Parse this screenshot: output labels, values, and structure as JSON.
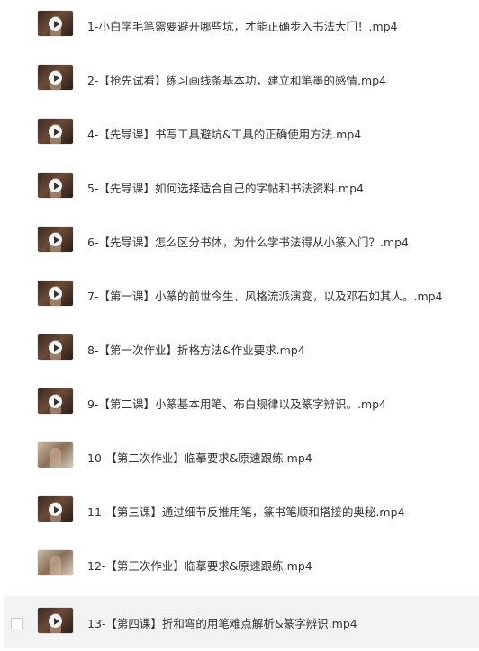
{
  "files": [
    {
      "name": "1-小白学毛笔需要避开哪些坑，才能正确步入书法大门！.mp4"
    },
    {
      "name": "2-【抢先试看】练习画线条基本功，建立和笔墨的感情.mp4"
    },
    {
      "name": "4-【先导课】书写工具避坑&工具的正确使用方法.mp4"
    },
    {
      "name": "5-【先导课】如何选择适合自己的字帖和书法资料.mp4"
    },
    {
      "name": "6-【先导课】怎么区分书体，为什么学书法得从小篆入门？.mp4"
    },
    {
      "name": "7-【第一课】小篆的前世今生、风格流派演变，以及邓石如其人。.mp4"
    },
    {
      "name": "8-【第一次作业】折格方法&作业要求.mp4"
    },
    {
      "name": "9-【第二课】小篆基本用笔、布白规律以及篆字辨识。.mp4"
    },
    {
      "name": "10-【第二次作业】临摹要求&原速跟练.mp4"
    },
    {
      "name": "11-【第三课】通过细节反推用笔，篆书笔顺和搭接的奥秘.mp4"
    },
    {
      "name": "12-【第三次作业】临摹要求&原速跟练.mp4"
    },
    {
      "name": "13-【第四课】折和弯的用笔难点解析&篆字辨识.mp4"
    }
  ],
  "icons": {
    "thumbnail": "video-thumbnail-icon",
    "play": "play-icon",
    "checkbox": "checkbox-icon"
  },
  "colors": {
    "text": "#333333",
    "hover_row": "#f3f3f3",
    "background": "#ffffff"
  }
}
